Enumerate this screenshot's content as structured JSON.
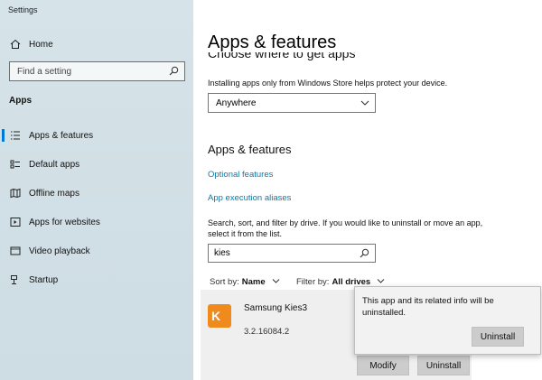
{
  "window": {
    "title": "Settings"
  },
  "sidebar": {
    "home_label": "Home",
    "search_placeholder": "Find a setting",
    "section_label": "Apps",
    "items": [
      {
        "label": "Apps & features",
        "icon": "list-icon",
        "active": true
      },
      {
        "label": "Default apps",
        "icon": "default-apps-icon",
        "active": false
      },
      {
        "label": "Offline maps",
        "icon": "map-icon",
        "active": false
      },
      {
        "label": "Apps for websites",
        "icon": "website-app-icon",
        "active": false
      },
      {
        "label": "Video playback",
        "icon": "video-icon",
        "active": false
      },
      {
        "label": "Startup",
        "icon": "startup-icon",
        "active": false
      }
    ]
  },
  "main": {
    "page_title": "Apps & features",
    "cut_heading": "Choose where to get apps",
    "install_desc": "Installing apps only from Windows Store helps protect your device.",
    "source_dropdown": {
      "value": "Anywhere"
    },
    "subsection_title": "Apps & features",
    "link_optional": "Optional features",
    "link_aliases": "App execution aliases",
    "help_text": "Search, sort, and filter by drive. If you would like to uninstall or move an app, select it from the list.",
    "filter_input": {
      "value": "kies"
    },
    "sort": {
      "label": "Sort by:",
      "value": "Name"
    },
    "filter": {
      "label": "Filter by:",
      "value": "All drives"
    },
    "app": {
      "name": "Samsung Kies3",
      "version": "3.2.16084.2",
      "icon_text": "K"
    },
    "modify_label": "Modify",
    "uninstall_label": "Uninstall"
  },
  "popup": {
    "message": "This app and its related info will be uninstalled.",
    "confirm_label": "Uninstall"
  },
  "colors": {
    "accent": "#0078d7",
    "link": "#0a7aa8",
    "sidebar_bg": "#d3e1e7",
    "app_icon": "#f08a1c"
  }
}
